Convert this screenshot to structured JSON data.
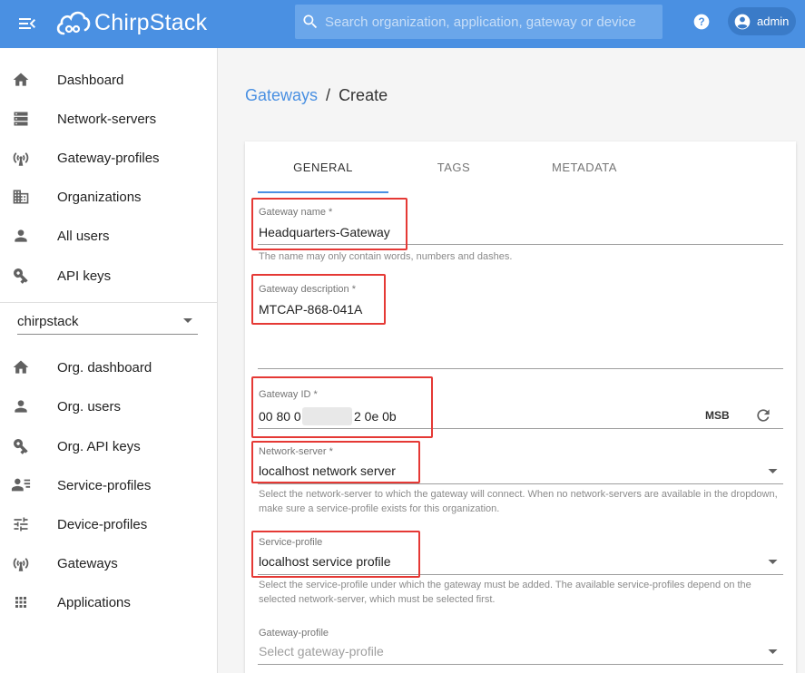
{
  "header": {
    "app_name": "ChirpStack",
    "search_placeholder": "Search organization, application, gateway or device",
    "user": "admin"
  },
  "sidebar": {
    "items": [
      {
        "label": "Dashboard",
        "icon": "home-icon"
      },
      {
        "label": "Network-servers",
        "icon": "server-icon"
      },
      {
        "label": "Gateway-profiles",
        "icon": "radio-tower-icon"
      },
      {
        "label": "Organizations",
        "icon": "building-icon"
      },
      {
        "label": "All users",
        "icon": "person-icon"
      },
      {
        "label": "API keys",
        "icon": "key-icon"
      }
    ],
    "org_selected": "chirpstack",
    "org_items": [
      {
        "label": "Org. dashboard",
        "icon": "home-icon"
      },
      {
        "label": "Org. users",
        "icon": "person-icon"
      },
      {
        "label": "Org. API keys",
        "icon": "key-icon"
      },
      {
        "label": "Service-profiles",
        "icon": "account-details-icon"
      },
      {
        "label": "Device-profiles",
        "icon": "tune-icon"
      },
      {
        "label": "Gateways",
        "icon": "radio-tower-icon"
      },
      {
        "label": "Applications",
        "icon": "apps-grid-icon"
      }
    ]
  },
  "breadcrumb": {
    "parent": "Gateways",
    "separator": "/",
    "current": "Create"
  },
  "tabs": [
    "GENERAL",
    "TAGS",
    "METADATA"
  ],
  "form": {
    "gateway_name": {
      "label": "Gateway name *",
      "value": "Headquarters-Gateway",
      "helper": "The name may only contain words, numbers and dashes."
    },
    "gateway_description": {
      "label": "Gateway description *",
      "value": "MTCAP-868-041A"
    },
    "gateway_id": {
      "label": "Gateway ID *",
      "value_prefix": "00 80 0",
      "value_suffix": "2 0e 0b",
      "byte_order": "MSB"
    },
    "network_server": {
      "label": "Network-server *",
      "value": "localhost network server",
      "helper": "Select the network-server to which the gateway will connect. When no network-servers are available in the dropdown, make sure a service-profile exists for this organization."
    },
    "service_profile": {
      "label": "Service-profile",
      "value": "localhost service profile",
      "helper": "Select the service-profile under which the gateway must be added. The available service-profiles depend on the selected network-server, which must be selected first."
    },
    "gateway_profile": {
      "label": "Gateway-profile",
      "placeholder": "Select gateway-profile"
    }
  },
  "colors": {
    "primary": "#4a90e2",
    "highlight": "#e53935"
  }
}
